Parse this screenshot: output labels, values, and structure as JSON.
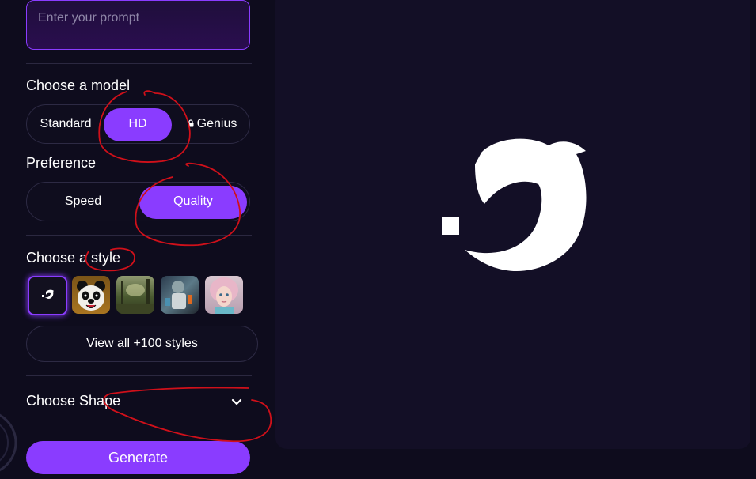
{
  "prompt": {
    "placeholder": "Enter your prompt"
  },
  "model": {
    "title": "Choose a model",
    "options": [
      "Standard",
      "HD",
      "Genius"
    ],
    "selected": "HD"
  },
  "preference": {
    "title": "Preference",
    "options": [
      "Speed",
      "Quality"
    ],
    "selected": "Quality"
  },
  "style": {
    "title": "Choose a style",
    "view_all_label": "View all +100 styles"
  },
  "shape": {
    "title": "Choose Shape"
  },
  "generate_label": "Generate",
  "colors": {
    "accent": "#8a3cff",
    "background": "#0e0c1d",
    "canvas": "#130f26",
    "annotation": "#d0101a"
  }
}
